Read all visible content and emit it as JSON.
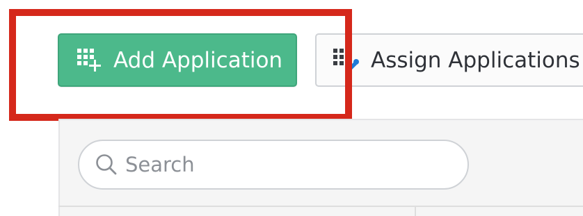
{
  "toolbar": {
    "add_button": {
      "label": "Add Application",
      "icon": "grid-plus-icon",
      "color": "#4cb98b"
    },
    "assign_button": {
      "label": "Assign Applications",
      "icon": "grid-assign-icon",
      "icon_accent": "#1f7bd8"
    }
  },
  "highlight": {
    "color": "#d5281b"
  },
  "search": {
    "placeholder": "Search",
    "value": "",
    "icon": "search-icon"
  }
}
